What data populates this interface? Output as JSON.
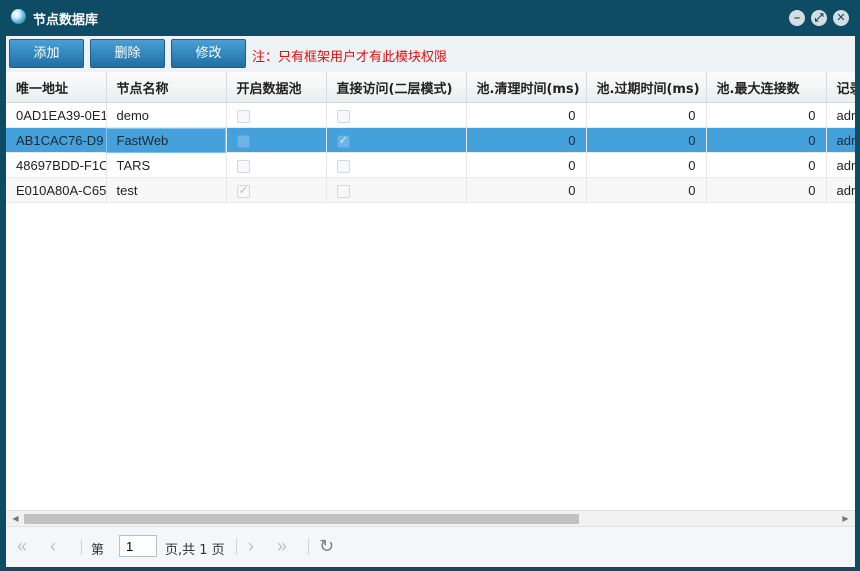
{
  "window": {
    "title": "节点数据库"
  },
  "toolbar": {
    "add_label": "添加",
    "delete_label": "删除",
    "edit_label": "修改",
    "notice": "注：只有框架用户才有此模块权限"
  },
  "table": {
    "columns": [
      "唯一地址",
      "节点名称",
      "开启数据池",
      "直接访问(二层模式)",
      "池.清理时间(ms)",
      "池.过期时间(ms)",
      "池.最大连接数",
      "记录"
    ],
    "rows": [
      {
        "address": "0AD1EA39-0E1",
        "name": "demo",
        "pool_enabled": false,
        "direct_access": false,
        "clean_ms": "0",
        "expire_ms": "0",
        "max_conn": "0",
        "recorder": "adm"
      },
      {
        "address": "AB1CAC76-D9",
        "name": "FastWeb",
        "pool_enabled": false,
        "direct_access": true,
        "clean_ms": "0",
        "expire_ms": "0",
        "max_conn": "0",
        "recorder": "adm",
        "selected": true
      },
      {
        "address": "48697BDD-F1C",
        "name": "TARS",
        "pool_enabled": false,
        "direct_access": false,
        "clean_ms": "0",
        "expire_ms": "0",
        "max_conn": "0",
        "recorder": "adm"
      },
      {
        "address": "E010A80A-C65",
        "name": "test",
        "pool_enabled": true,
        "direct_access": false,
        "clean_ms": "0",
        "expire_ms": "0",
        "max_conn": "0",
        "recorder": "adm"
      }
    ]
  },
  "pager": {
    "page_label": "第",
    "page_value": "1",
    "page_total_label": "页,共 1 页"
  },
  "icons": {
    "first": "first-page-icon",
    "prev": "prev-page-icon",
    "next": "next-page-icon",
    "last": "last-page-icon",
    "refresh": "refresh-icon"
  },
  "colors": {
    "titlebar": "#0e4b64",
    "button": "#2a7fb8",
    "notice": "#e01010",
    "selected_row": "#45a1dc"
  }
}
